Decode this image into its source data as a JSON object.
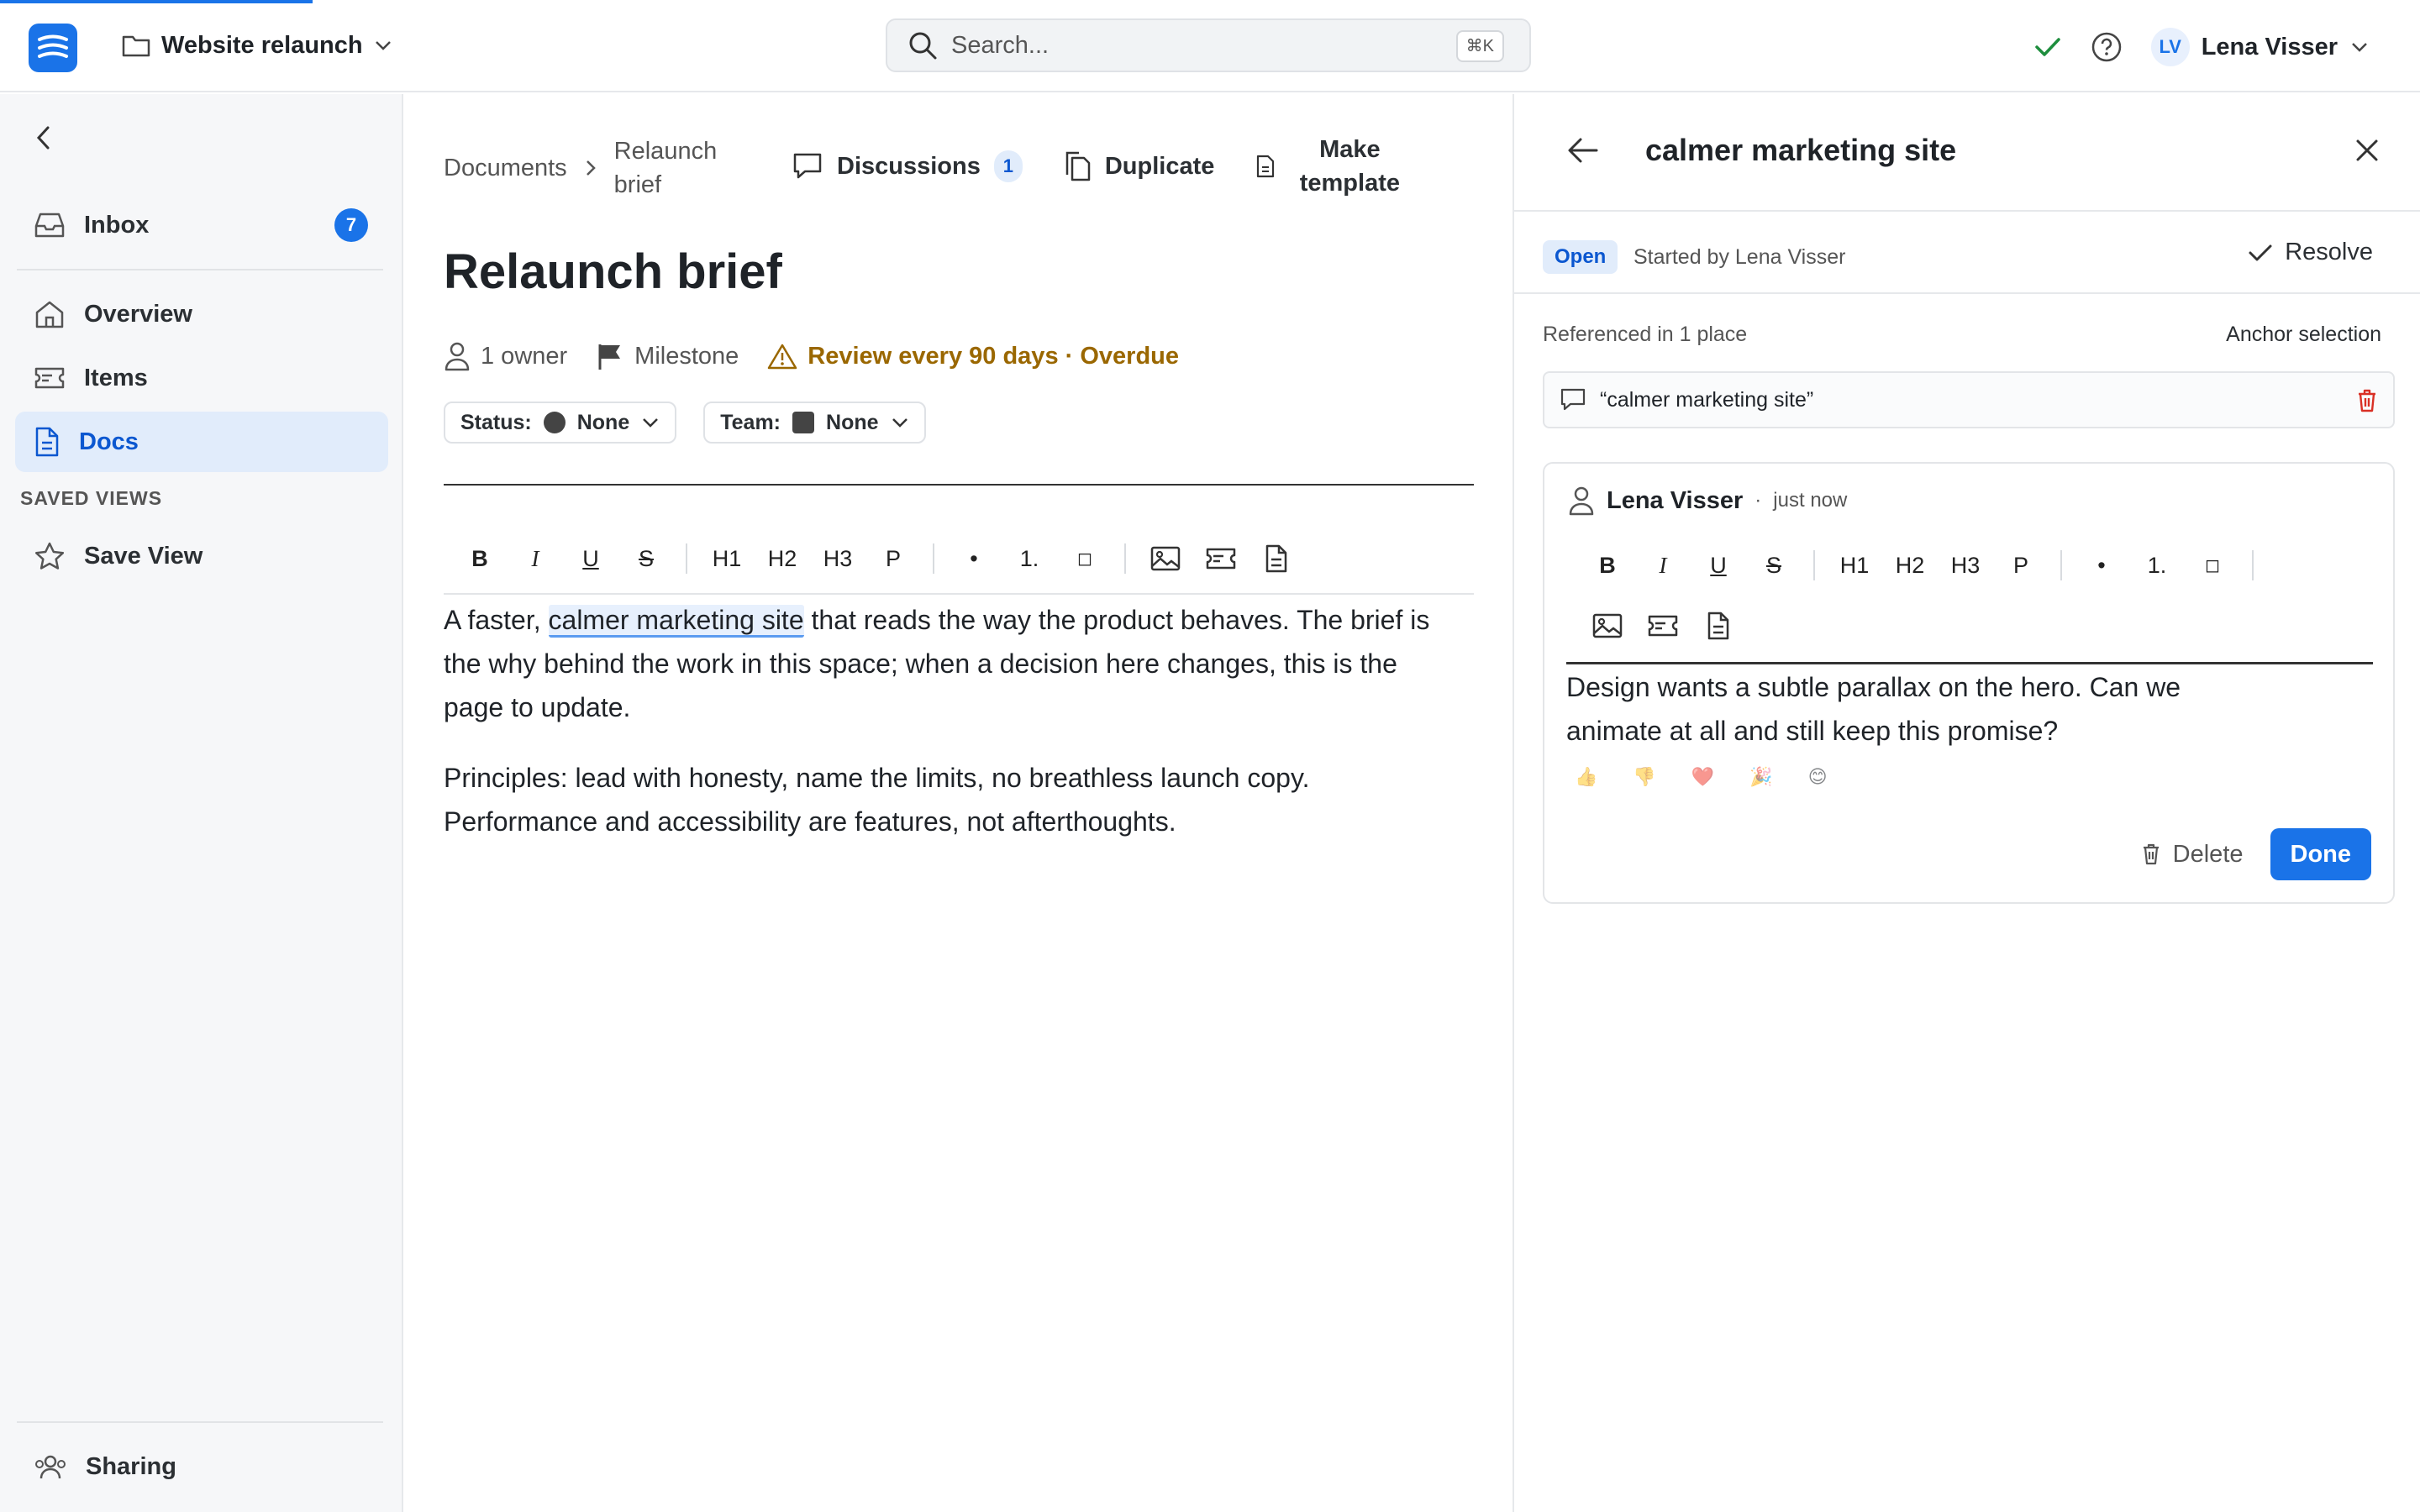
{
  "header": {
    "project": "Website relaunch",
    "search_placeholder": "Search...",
    "search_shortcut": "⌘K",
    "user_initials": "LV",
    "user_name": "Lena Visser"
  },
  "sidebar": {
    "items": [
      {
        "label": "Inbox",
        "badge": "7"
      },
      {
        "label": "Overview"
      },
      {
        "label": "Items"
      },
      {
        "label": "Docs"
      }
    ],
    "saved_views_heading": "SAVED VIEWS",
    "save_view": "Save View",
    "sharing": "Sharing"
  },
  "document": {
    "breadcrumb": [
      "Documents",
      "Relaunch brief"
    ],
    "actions": {
      "discussions": "Discussions",
      "discussions_count": "1",
      "duplicate": "Duplicate",
      "make_template": "Make template"
    },
    "title": "Relaunch brief",
    "meta": {
      "owners": "1 owner",
      "milestone": "Milestone",
      "review": "Review every 90 days · Overdue"
    },
    "status_label": "Status:",
    "status_value": "None",
    "team_label": "Team:",
    "team_value": "None",
    "toolbar": [
      "B",
      "I",
      "U",
      "S",
      "H1",
      "H2",
      "H3",
      "P",
      "•",
      "1.",
      "◻"
    ],
    "paragraph1_before": "A faster, ",
    "paragraph1_highlight": "calmer marketing site",
    "paragraph1_after": " that reads the way the product behaves. The brief is the why behind the work in this space; when a decision here changes, this is the page to update.",
    "paragraph2": "Principles: lead with honesty, name the limits, no breathless launch copy. Performance and accessibility are features, not afterthoughts."
  },
  "discussion": {
    "title": "calmer marketing site",
    "status": "Open",
    "started_by": "Started by Lena Visser",
    "resolve": "Resolve",
    "referenced": "Referenced in 1 place",
    "anchor_selection": "Anchor selection",
    "quote": "“calmer marketing site”",
    "comment": {
      "author": "Lena Visser",
      "time": "just now",
      "text": "Design wants a subtle parallax on the hero. Can we animate at all and still keep this promise?",
      "reactions": [
        "👍",
        "👎",
        "❤️",
        "🎉",
        "😊"
      ]
    },
    "delete": "Delete",
    "done": "Done"
  },
  "colors": {
    "accent": "#1a73e8",
    "warning": "#9a6700",
    "success": "#1e8e3e",
    "danger": "#d93025"
  }
}
